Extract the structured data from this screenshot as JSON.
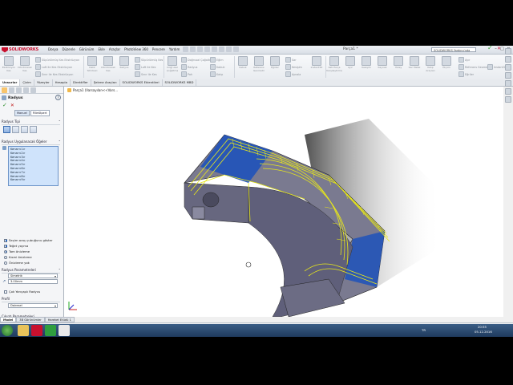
{
  "app": {
    "logo_text": "SOLIDWORKS",
    "document_title": "Parça1 *",
    "search_placeholder": "SOLIDWORKS Yardımı'nda ara",
    "window_buttons": [
      "–",
      "□",
      "✕"
    ]
  },
  "menu": [
    "Dosya",
    "Düzenle",
    "Görünüm",
    "Ekle",
    "Araçlar",
    "PhotoView 360",
    "Pencere",
    "Yardım"
  ],
  "ribbon": {
    "small_buttons": [
      "Süpürülmüş Kes Ekstrüzyon",
      "Loft ile Kes Ekstrüzyon",
      "Sınır ile Kes Ekstrüzyon",
      "Süpürülmüş Kes",
      "Loft ile Kes",
      "Sınır ile Kes",
      "Doğrusal Çoğaltma",
      "Radyus",
      "Pah",
      "Eğim",
      "Kabuk",
      "Kalıp",
      "Sar",
      "Kesişim",
      "Aynala",
      "Ayır",
      "Referans Geometri",
      "Eğriler",
      "Instant3D"
    ],
    "big_buttons": [
      "Ekstrüzyon Kes",
      "Döndürerek Kes",
      "Delik Sihirbazı",
      "Döndürerek Kes",
      "Radyus",
      "Doğrusal Çoğaltma",
      "Kabuk",
      "Referans Geometri",
      "Eğriler",
      "Instant3D",
      "Katı Parça Karşılaştırma",
      "Ayır",
      "Kesişim",
      "Kaynak",
      "Yüzey",
      "Sac Metal",
      "Kalıp Araçları",
      "Ölçüm"
    ]
  },
  "cmd_tabs": [
    "Unsurlar",
    "Çizim",
    "Yüzeyler",
    "Hesapla",
    "Direktifler",
    "Şekme Araçları",
    "SOLIDWORKS Eklentileri",
    "SOLIDWORKS MBD"
  ],
  "pm": {
    "title": "Radyus",
    "help": "?",
    "ok": "✓",
    "cancel": "✕",
    "manual_tab": "Manuel",
    "filletxpert_tab": "FilletXpert",
    "group_type": "Radyus Tipi",
    "group_items": "Radyus Uygulanacak Öğeler",
    "edge_list": [
      "Kenar<1>",
      "Kenar<2>",
      "Kenar<3>",
      "Kenar<4>",
      "Kenar<5>",
      "Kenar<6>",
      "Kenar<7>",
      "Kenar<8>",
      "Kenar<9>"
    ],
    "option_show_toolbar": "Seçim araç çubuğunu göster",
    "option_tangent": "Teğet yayma",
    "preview_full": "Tam önizleme",
    "preview_partial": "Kısmi önizleme",
    "preview_none": "Önizleme yok",
    "group_params": "Radyus Parametreleri",
    "method_value": "Simetrik",
    "radius_value": "3.00mm",
    "option_multi_radius": "Çok Yarıçaplı Radyus",
    "group_profile": "Profil",
    "profile_value": "Dairesel",
    "group_setback": "Çıkıntı Parametreleri",
    "group_options": "Radyus Seçenekleri"
  },
  "pm_bottom_tabs": [
    "Model",
    "3B Görünümler",
    "Hareket Etüdü 1"
  ],
  "viewport": {
    "feature_breadcrumb": "Parça1 (Varsayılan<<Vars..."
  },
  "status": {
    "left": "SOLIDWORKS Premium 2016 x64 Sürümü",
    "right1": "Düzenleme Parça",
    "right2": "MMGS"
  },
  "taskbar": {
    "apps": [
      "Windows Explorer",
      "SOLIDWORKS",
      "Camtasia",
      "Camtasia Recorder"
    ],
    "tray_lang": "TR",
    "clock": "20:55",
    "date": "05.12.2016"
  },
  "colors": {
    "part_body": "#5d5d78",
    "part_face_highlight": "#2454b8",
    "fillet_preview": "#e8e81a"
  }
}
